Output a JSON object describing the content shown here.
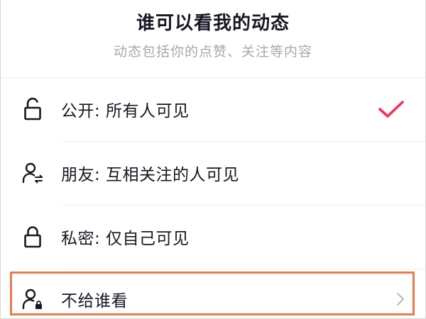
{
  "header": {
    "title": "谁可以看我的动态",
    "subtitle": "动态包括你的点赞、关注等内容"
  },
  "options": [
    {
      "label": "公开: 所有人可见",
      "icon": "unlock-icon",
      "selected": true
    },
    {
      "label": "朋友: 互相关注的人可见",
      "icon": "user-mutual-icon",
      "selected": false
    },
    {
      "label": "私密: 仅自己可见",
      "icon": "lock-icon",
      "selected": false
    },
    {
      "label": "不给谁看",
      "icon": "user-lock-icon",
      "selected": false,
      "has_submenu": true,
      "highlighted": true
    }
  ],
  "colors": {
    "check": "#fe2c55",
    "highlight_border": "#ef7a4b",
    "subtitle": "#a8a8ad",
    "chevron": "#b8b8bc"
  }
}
